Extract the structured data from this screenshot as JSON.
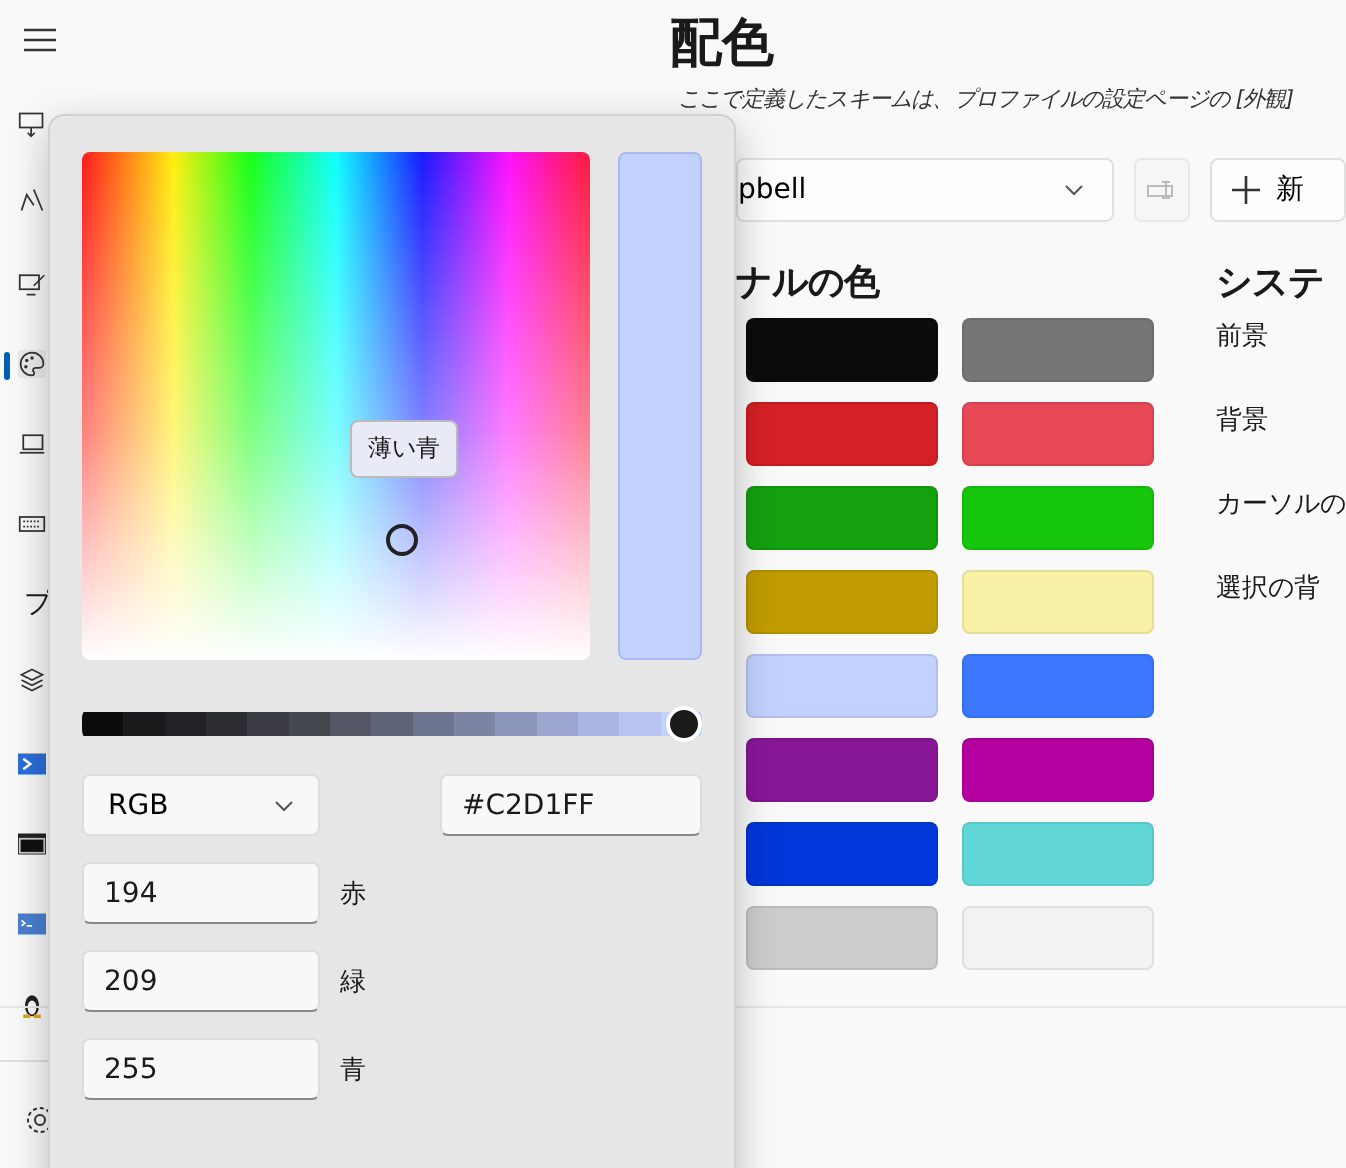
{
  "header": {
    "title": "配色",
    "subtitle": "ここで定義したスキームは、プロファイルの設定ページの [外観]"
  },
  "sidebar": {
    "items": [
      {
        "kind": "monitor",
        "selected": false
      },
      {
        "kind": "pen",
        "selected": false
      },
      {
        "kind": "screen-pen",
        "selected": false
      },
      {
        "kind": "palette",
        "selected": true
      },
      {
        "kind": "laptop",
        "selected": false
      },
      {
        "kind": "keyboard",
        "selected": false
      },
      {
        "kind": "text",
        "label": "プ",
        "selected": false
      },
      {
        "kind": "layers",
        "selected": false
      },
      {
        "kind": "powershell",
        "selected": false
      },
      {
        "kind": "cmd",
        "selected": false
      },
      {
        "kind": "terminal",
        "selected": false
      },
      {
        "kind": "penguin",
        "selected": false
      }
    ]
  },
  "scheme_select": {
    "value": "pbell"
  },
  "new_button": {
    "label": "新"
  },
  "terminal_colors": {
    "heading": "ナルの色",
    "swatches": [
      {
        "color": "#0c0c0c"
      },
      {
        "color": "#767676"
      },
      {
        "color": "#d42026"
      },
      {
        "color": "#e74856"
      },
      {
        "color": "#13a10e"
      },
      {
        "color": "#16c60c"
      },
      {
        "color": "#c19c00"
      },
      {
        "color": "#f9f1a5"
      },
      {
        "color": "#c2d1ff"
      },
      {
        "color": "#3b78ff"
      },
      {
        "color": "#881798"
      },
      {
        "color": "#b4009e"
      },
      {
        "color": "#0037da"
      },
      {
        "color": "#61d6d6"
      },
      {
        "color": "#cccccc"
      },
      {
        "color": "#f2f2f2"
      }
    ]
  },
  "system_colors": {
    "heading": "システ",
    "items": [
      "前景",
      "背景",
      "カーソルの",
      "選択の背"
    ]
  },
  "color_picker": {
    "tooltip": "薄い青",
    "brightness": {
      "level": 1
    },
    "mode": "RGB",
    "hex": "#C2D1FF",
    "channels": [
      {
        "value": "194",
        "label": "赤"
      },
      {
        "value": "209",
        "label": "緑"
      },
      {
        "value": "255",
        "label": "青"
      }
    ]
  }
}
